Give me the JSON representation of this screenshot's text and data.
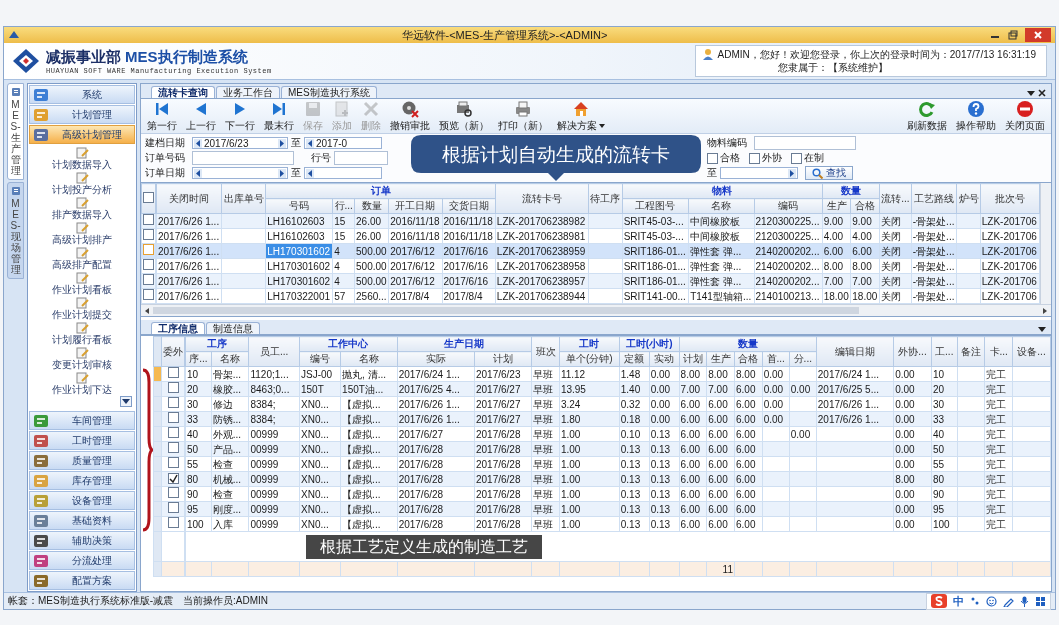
{
  "window": {
    "title": "华远软件-<MES-生产管理系统>-<ADMIN>"
  },
  "header": {
    "brand": "减振事业部",
    "product": "MES执行制造系统",
    "subtitle": "HUAYUAN SOFT WARE Manufacturing Execution System",
    "greeting": "ADMIN，您好！欢迎您登录，你上次的登录时间为：2017/7/13 16:31:19",
    "affiliation": "您隶属于：【系统维护】"
  },
  "side_tabs": [
    {
      "label": "MES-生产管理",
      "selected": true
    },
    {
      "label": "MES-现场管理",
      "selected": false
    }
  ],
  "sidebar": {
    "groups": [
      {
        "label": "系统",
        "selected": false
      },
      {
        "label": "计划管理",
        "selected": false
      },
      {
        "label": "高级计划管理",
        "selected": true,
        "children": [
          "计划数据导入",
          "计划投产分析",
          "排产数据导入",
          "高级计划排产",
          "高级排产配置",
          "作业计划看板",
          "作业计划提交",
          "计划履行看板",
          "变更计划审核",
          "作业计划下达"
        ]
      },
      {
        "label": "车间管理",
        "selected": false
      },
      {
        "label": "工时管理",
        "selected": false
      },
      {
        "label": "质量管理",
        "selected": false
      },
      {
        "label": "库存管理",
        "selected": false
      },
      {
        "label": "设备管理",
        "selected": false
      },
      {
        "label": "基础资料",
        "selected": false
      },
      {
        "label": "辅助决策",
        "selected": false
      },
      {
        "label": "分流处理",
        "selected": false
      },
      {
        "label": "配置方案",
        "selected": false
      }
    ]
  },
  "tabs": [
    {
      "label": "流转卡查询",
      "selected": true
    },
    {
      "label": "业务工作台",
      "selected": false
    },
    {
      "label": "MES制造执行系统",
      "selected": false
    }
  ],
  "toolbar": [
    {
      "kind": "first",
      "label": "第一行",
      "disabled": false
    },
    {
      "kind": "prev",
      "label": "上一行",
      "disabled": false
    },
    {
      "kind": "next",
      "label": "下一行",
      "disabled": false
    },
    {
      "kind": "last",
      "label": "最末行",
      "disabled": false
    },
    {
      "kind": "save",
      "label": "保存",
      "disabled": true
    },
    {
      "kind": "add",
      "label": "添加",
      "disabled": true
    },
    {
      "kind": "delete",
      "label": "删除",
      "disabled": true
    },
    {
      "kind": "revoke",
      "label": "撤销审批",
      "disabled": false
    },
    {
      "kind": "preview",
      "label": "预览（新）",
      "disabled": false
    },
    {
      "kind": "print",
      "label": "打印（新）",
      "disabled": false
    },
    {
      "kind": "solution",
      "label": "解决方案",
      "disabled": false
    }
  ],
  "toolbar_right": [
    {
      "kind": "refresh",
      "label": "刷新数据",
      "disabled": false
    },
    {
      "kind": "help",
      "label": "操作帮助",
      "disabled": false
    },
    {
      "kind": "close",
      "label": "关闭页面",
      "disabled": false
    }
  ],
  "filters": {
    "created_date": {
      "label": "建档日期",
      "from": "2017/6/23",
      "to_label": "至",
      "to": "2017-0"
    },
    "order_no": {
      "label": "订单号码"
    },
    "line_no": {
      "label": "行号"
    },
    "order_date": {
      "label": "订单日期",
      "to_label": "至"
    },
    "range_3": {
      "to_label": "至"
    },
    "material_code": {
      "label": "物料编码"
    },
    "checkboxes": [
      {
        "label": "合格",
        "checked": false
      },
      {
        "label": "外协",
        "checked": false
      },
      {
        "label": "在制",
        "checked": false
      }
    ],
    "search_button": "查找"
  },
  "callout": "根据计划自动生成的流转卡",
  "upper_grid": {
    "select_all": false,
    "columns": [
      {
        "label": "关闭时间"
      },
      {
        "label": "出库单号"
      },
      {
        "label": "订单",
        "colspan": 5,
        "children": [
          "号码",
          "行...",
          "数量",
          "开工日期",
          "交货日期"
        ]
      },
      {
        "label": "流转卡号"
      },
      {
        "label": "待工序"
      },
      {
        "label": "物料",
        "colspan": 3,
        "children": [
          "工程图号",
          "名称",
          "编码"
        ]
      },
      {
        "label": "数量",
        "colspan": 2,
        "children": [
          "生产",
          "合格"
        ]
      },
      {
        "label": "流转..."
      },
      {
        "label": "工艺路线"
      },
      {
        "label": "炉号"
      },
      {
        "label": "批次号"
      }
    ],
    "rows": [
      {
        "checked": false,
        "selected": false,
        "cells": [
          "2017/6/26 1...",
          "",
          "LH16102603",
          "15",
          "26.00",
          "2016/11/18",
          "2016/11/18",
          "LZK-201706238982",
          "",
          "SRIT45-03-...",
          "中间橡胶板",
          "2120300225...",
          "9.00",
          "9.00",
          "关闭",
          "-骨架处...",
          "",
          "LZK-201706"
        ]
      },
      {
        "checked": false,
        "selected": false,
        "cells": [
          "2017/6/26 1...",
          "",
          "LH16102603",
          "15",
          "26.00",
          "2016/11/18",
          "2016/11/18",
          "LZK-201706238981",
          "",
          "SRIT45-03-...",
          "中间橡胶板",
          "2120300225...",
          "4.00",
          "4.00",
          "关闭",
          "-骨架处...",
          "",
          "LZK-201706"
        ]
      },
      {
        "checked": false,
        "selected": true,
        "cells": [
          "2017/6/26 1...",
          "",
          "LH170301602",
          "4",
          "500.00",
          "2017/6/12",
          "2017/6/16",
          "LZK-201706238959",
          "",
          "SRIT186-01...",
          "弹性套 弹...",
          "2140200202...",
          "6.00",
          "6.00",
          "关闭",
          "-骨架处...",
          "",
          "LZK-201706"
        ]
      },
      {
        "checked": false,
        "selected": false,
        "cells": [
          "2017/6/26 1...",
          "",
          "LH170301602",
          "4",
          "500.00",
          "2017/6/12",
          "2017/6/16",
          "LZK-201706238958",
          "",
          "SRIT186-01...",
          "弹性套 弹...",
          "2140200202...",
          "8.00",
          "8.00",
          "关闭",
          "-骨架处...",
          "",
          "LZK-201706"
        ]
      },
      {
        "checked": false,
        "selected": false,
        "cells": [
          "2017/6/26 1...",
          "",
          "LH170301602",
          "4",
          "500.00",
          "2017/6/12",
          "2017/6/16",
          "LZK-201706238957",
          "",
          "SRIT186-01...",
          "弹性套 弹...",
          "2140200202...",
          "7.00",
          "7.00",
          "关闭",
          "-骨架处...",
          "",
          "LZK-201706"
        ]
      },
      {
        "checked": false,
        "selected": false,
        "cells": [
          "2017/6/26 1...",
          "",
          "LH170322001",
          "57",
          "2560...",
          "2017/8/4",
          "2017/8/4",
          "LZK-201706238944",
          "",
          "SRIT141-00...",
          "T141型轴箱...",
          "2140100213...",
          "18.00",
          "18.00",
          "关闭",
          "-骨架处...",
          "",
          "LZK-201706"
        ]
      }
    ]
  },
  "lower_tabs": [
    {
      "label": "工序信息",
      "selected": true
    },
    {
      "label": "制造信息",
      "selected": false
    }
  ],
  "lower_grid": {
    "outsourced_header": "委外",
    "columns": [
      {
        "label": "工序",
        "colspan": 2,
        "children": [
          "序...",
          "名称"
        ]
      },
      {
        "label": "员工..."
      },
      {
        "label": "工作中心",
        "colspan": 2,
        "children": [
          "编号",
          "名称"
        ]
      },
      {
        "label": "生产日期",
        "colspan": 2,
        "children": [
          "实际",
          "计划"
        ]
      },
      {
        "label": "班次"
      },
      {
        "label": "工时",
        "children": [
          "单个(分钟)"
        ]
      },
      {
        "label": "工时(小时)",
        "colspan": 2,
        "children": [
          "定额",
          "实动"
        ]
      },
      {
        "label": "数量",
        "colspan": 5,
        "children": [
          "计划",
          "生产",
          "合格",
          "首...",
          "分..."
        ]
      },
      {
        "label": "编辑日期"
      },
      {
        "label": "外协..."
      },
      {
        "label": "工..."
      },
      {
        "label": "备注"
      },
      {
        "label": "卡..."
      },
      {
        "label": "设备..."
      }
    ],
    "rows": [
      {
        "selected": true,
        "outsourced": false,
        "cells": [
          "10",
          "骨架...",
          "1120;1...",
          "JSJ-00",
          "抛丸, 清...",
          "2017/6/24 1...",
          "2017/6/23",
          "早班",
          "11.12",
          "1.48",
          "0.00",
          "8.00",
          "8.00",
          "8.00",
          "0.00",
          "",
          "2017/6/24 1...",
          "0.00",
          "10",
          "",
          "完工",
          ""
        ]
      },
      {
        "selected": false,
        "outsourced": false,
        "cells": [
          "20",
          "橡胶...",
          "8463;0...",
          "150T",
          "150T油...",
          "2017/6/25 4...",
          "2017/6/27",
          "早班",
          "13.95",
          "1.40",
          "0.00",
          "7.00",
          "7.00",
          "6.00",
          "0.00",
          "0.00",
          "2017/6/25 5...",
          "0.00",
          "20",
          "",
          "完工",
          ""
        ]
      },
      {
        "selected": false,
        "outsourced": false,
        "cells": [
          "30",
          "修边",
          "8384;",
          "XN0...",
          "【虚拟...",
          "2017/6/26 1...",
          "2017/6/27",
          "早班",
          "3.24",
          "0.32",
          "0.00",
          "6.00",
          "6.00",
          "6.00",
          "0.00",
          "",
          "2017/6/26 1...",
          "0.00",
          "30",
          "",
          "完工",
          ""
        ]
      },
      {
        "selected": false,
        "outsourced": false,
        "cells": [
          "33",
          "防锈...",
          "8384;",
          "XN0...",
          "【虚拟...",
          "2017/6/26 1...",
          "2017/6/27",
          "早班",
          "1.80",
          "0.18",
          "0.00",
          "6.00",
          "6.00",
          "6.00",
          "0.00",
          "",
          "2017/6/26 1...",
          "0.00",
          "33",
          "",
          "完工",
          ""
        ]
      },
      {
        "selected": false,
        "outsourced": false,
        "cells": [
          "40",
          "外观...",
          "00999",
          "XN0...",
          "【虚拟...",
          "2017/6/27",
          "2017/6/28",
          "早班",
          "1.00",
          "0.10",
          "0.13",
          "6.00",
          "6.00",
          "6.00",
          "",
          "0.00",
          "",
          "0.00",
          "40",
          "",
          "完工",
          ""
        ]
      },
      {
        "selected": false,
        "outsourced": false,
        "cells": [
          "50",
          "产品...",
          "00999",
          "XN0...",
          "【虚拟...",
          "2017/6/28",
          "2017/6/28",
          "早班",
          "1.00",
          "0.13",
          "0.13",
          "6.00",
          "6.00",
          "6.00",
          "",
          "",
          "",
          "0.00",
          "50",
          "",
          "完工",
          ""
        ]
      },
      {
        "selected": false,
        "outsourced": false,
        "cells": [
          "55",
          "检查",
          "00999",
          "XN0...",
          "【虚拟...",
          "2017/6/28",
          "2017/6/28",
          "早班",
          "1.00",
          "0.13",
          "0.13",
          "6.00",
          "6.00",
          "6.00",
          "",
          "",
          "",
          "0.00",
          "55",
          "",
          "完工",
          ""
        ]
      },
      {
        "selected": false,
        "outsourced": true,
        "cells": [
          "80",
          "机械...",
          "00999",
          "XN0...",
          "【虚拟...",
          "2017/6/28",
          "2017/6/28",
          "早班",
          "1.00",
          "0.13",
          "0.13",
          "6.00",
          "6.00",
          "6.00",
          "",
          "",
          "",
          "8.00",
          "80",
          "",
          "完工",
          ""
        ]
      },
      {
        "selected": false,
        "outsourced": false,
        "cells": [
          "90",
          "检查",
          "00999",
          "XN0...",
          "【虚拟...",
          "2017/6/28",
          "2017/6/28",
          "早班",
          "1.00",
          "0.13",
          "0.13",
          "6.00",
          "6.00",
          "6.00",
          "",
          "",
          "",
          "0.00",
          "90",
          "",
          "完工",
          ""
        ]
      },
      {
        "selected": false,
        "outsourced": false,
        "cells": [
          "95",
          "刚度...",
          "00999",
          "XN0...",
          "【虚拟...",
          "2017/6/28",
          "2017/6/28",
          "早班",
          "1.00",
          "0.13",
          "0.13",
          "6.00",
          "6.00",
          "6.00",
          "",
          "",
          "",
          "0.00",
          "95",
          "",
          "完工",
          ""
        ]
      },
      {
        "selected": false,
        "outsourced": false,
        "cells": [
          "100",
          "入库",
          "00999",
          "XN0...",
          "【虚拟...",
          "2017/6/28",
          "2017/6/28",
          "早班",
          "1.00",
          "0.13",
          "0.13",
          "6.00",
          "6.00",
          "6.00",
          "",
          "",
          "",
          "0.00",
          "100",
          "",
          "完工",
          ""
        ]
      }
    ],
    "footer": {
      "count": "11"
    }
  },
  "caption": "根据工艺定义生成的制造工艺",
  "status_bar": {
    "account": "帐套：MES制造执行系统标准版-减震",
    "operator": "当前操作员:ADMIN"
  },
  "ime": {
    "label": "中"
  }
}
